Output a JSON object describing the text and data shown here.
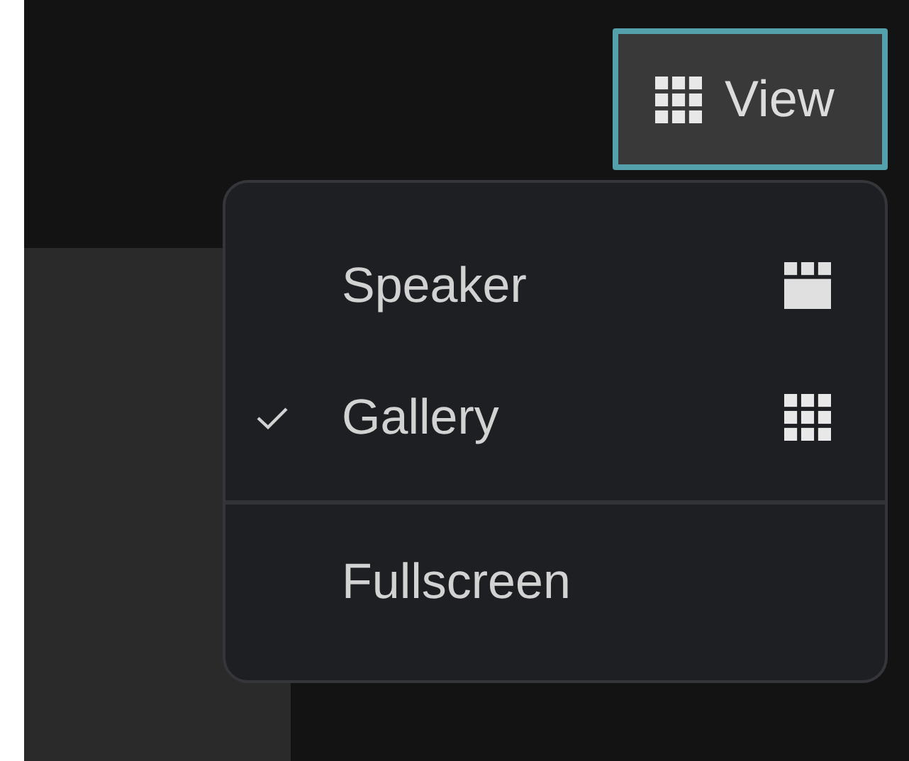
{
  "view_button": {
    "label": "View",
    "focused": true
  },
  "view_menu": {
    "options": [
      {
        "label": "Speaker",
        "selected": false
      },
      {
        "label": "Gallery",
        "selected": true
      }
    ],
    "actions": [
      {
        "label": "Fullscreen"
      }
    ]
  }
}
